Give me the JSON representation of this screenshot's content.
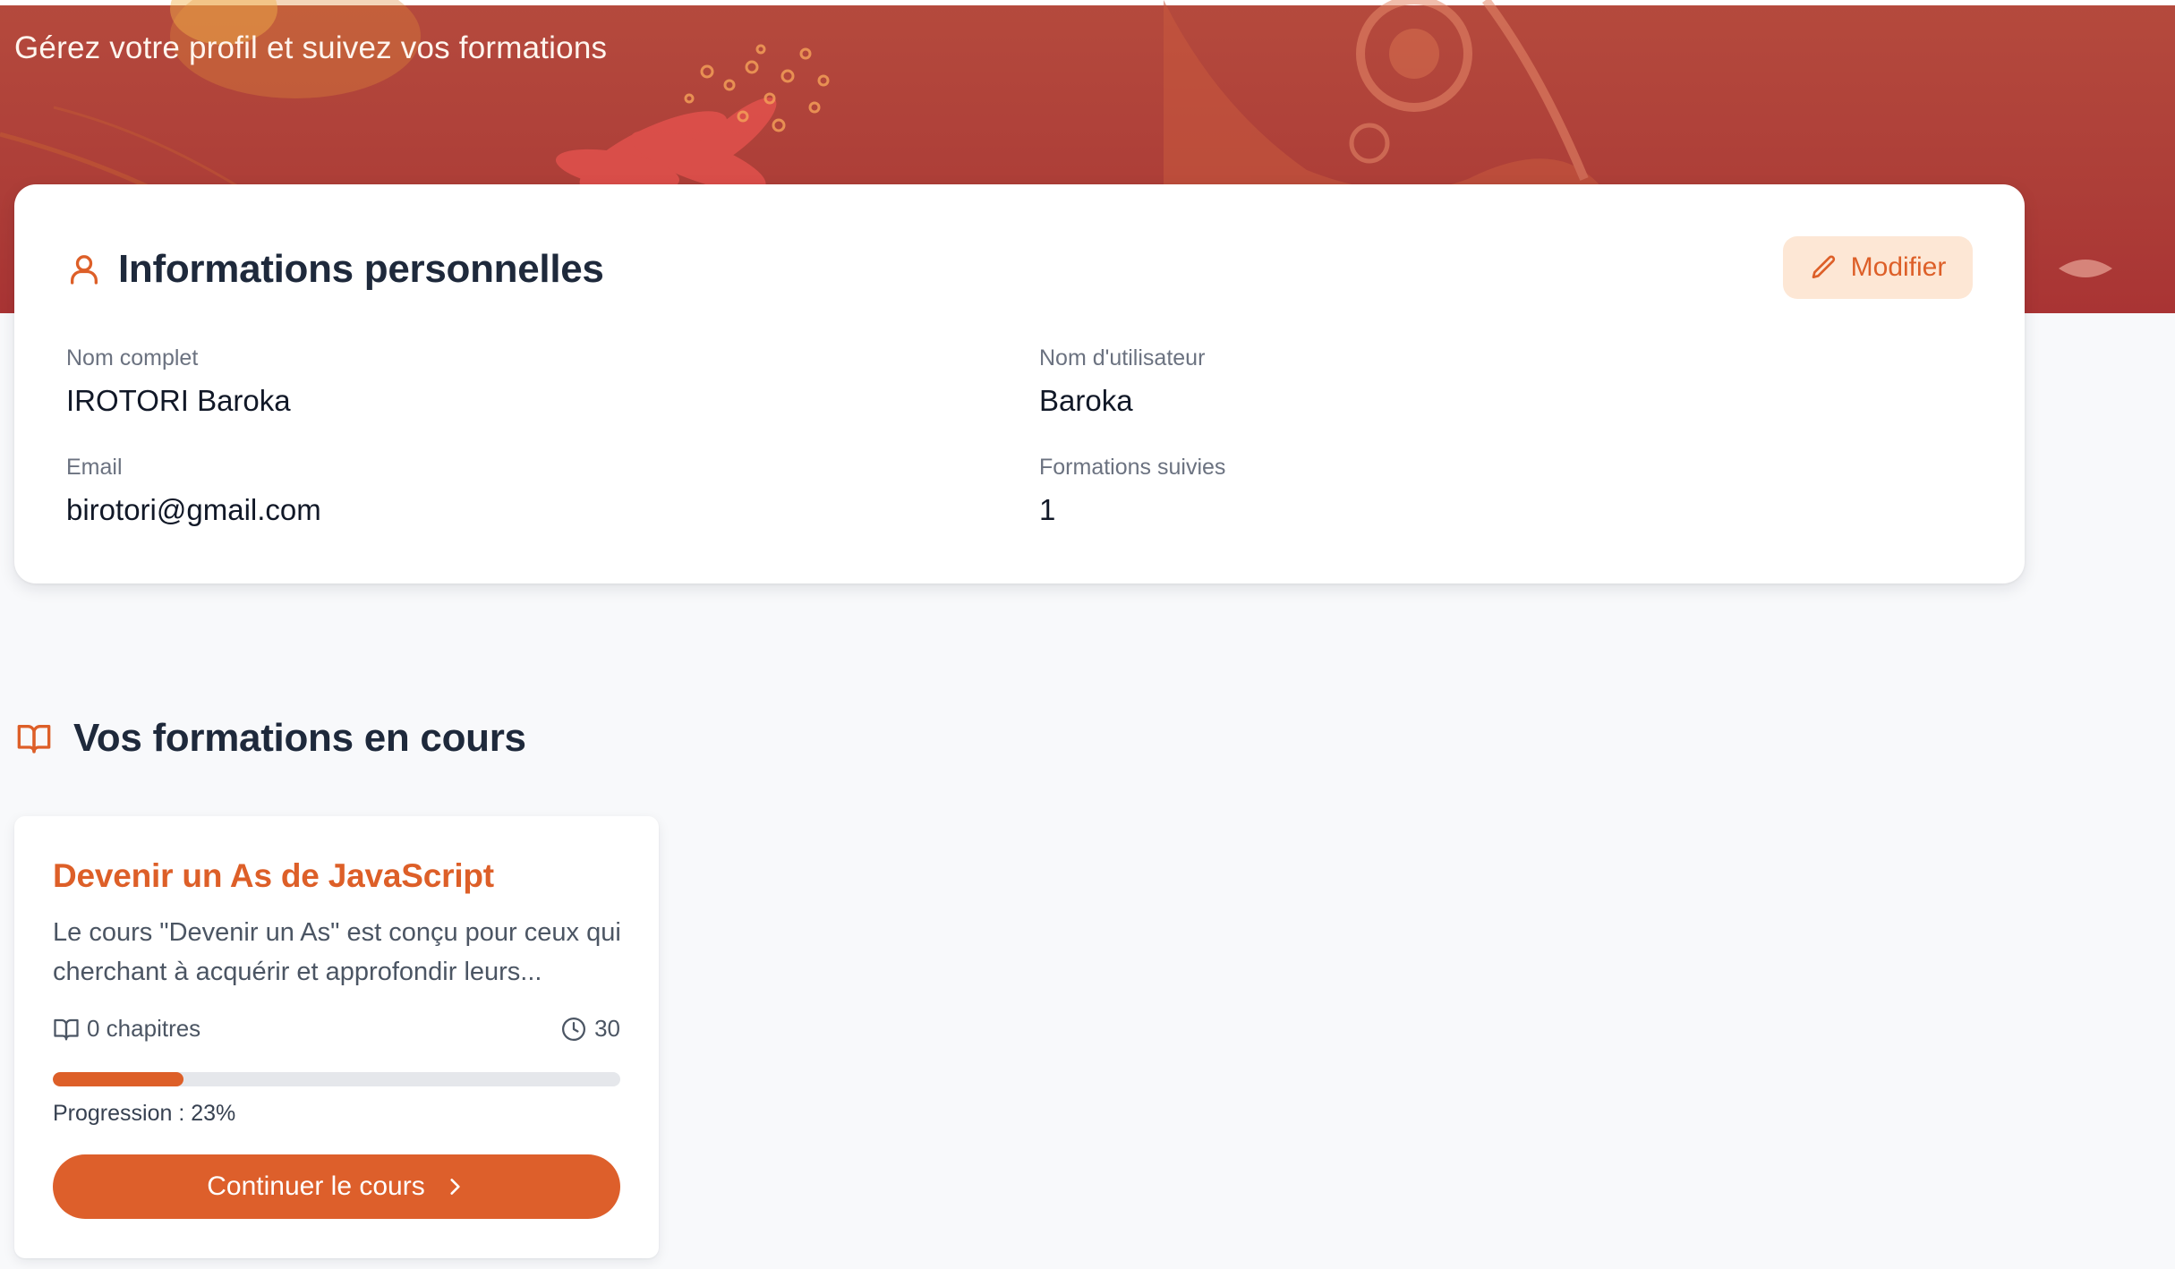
{
  "header": {
    "subtitle": "Gérez votre profil et suivez vos formations"
  },
  "profile": {
    "title": "Informations personnelles",
    "title_icon": "user-icon",
    "edit_label": "Modifier",
    "edit_icon": "pencil-icon",
    "fields": [
      {
        "label": "Nom complet",
        "value": "IROTORI Baroka"
      },
      {
        "label": "Nom d'utilisateur",
        "value": "Baroka"
      },
      {
        "label": "Email",
        "value": "birotori@gmail.com"
      },
      {
        "label": "Formations suivies",
        "value": "1"
      }
    ]
  },
  "courses": {
    "title": "Vos formations en cours",
    "title_icon": "book-open-icon",
    "items": [
      {
        "title": "Devenir un As de JavaScript",
        "description": "Le cours \"Devenir un As\" est conçu pour ceux qui cherchant à acquérir et approfondir leurs...",
        "chapters": "0 chapitres",
        "duration": "30",
        "progress_percent": 23,
        "progress_text": "Progression : 23%",
        "button_label": "Continuer le cours"
      }
    ]
  },
  "colors": {
    "accent": "#dd5f28",
    "accent_light": "#fde7d5",
    "banner": "#b04238",
    "text_dark": "#1e293b",
    "text_muted": "#6b7280",
    "background": "#f8f9fb"
  }
}
